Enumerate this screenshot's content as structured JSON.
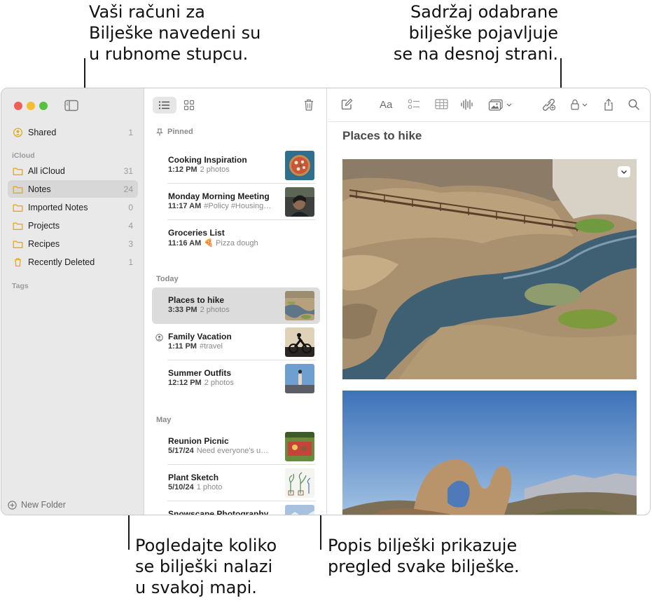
{
  "callouts": {
    "top_left": [
      "Vaši računi za",
      "Bilješke navedeni su",
      "u rubnome stupcu."
    ],
    "top_right": [
      "Sadržaj odabrane",
      "bilješke pojavljuje",
      "se na desnoj strani."
    ],
    "bottom_left": [
      "Pogledajte koliko",
      "se bilješki nalazi",
      "u svakoj mapi."
    ],
    "bottom_right": [
      "Popis bilješki prikazuje",
      "pregled svake bilješke."
    ]
  },
  "sidebar": {
    "shared": {
      "label": "Shared",
      "count": "1"
    },
    "account_header": "iCloud",
    "folders": [
      {
        "label": "All iCloud",
        "count": "31"
      },
      {
        "label": "Notes",
        "count": "24",
        "selected": true
      },
      {
        "label": "Imported Notes",
        "count": "0"
      },
      {
        "label": "Projects",
        "count": "4"
      },
      {
        "label": "Recipes",
        "count": "3"
      },
      {
        "label": "Recently Deleted",
        "count": "1"
      }
    ],
    "tags_header": "Tags",
    "new_folder": "New Folder"
  },
  "note_list": {
    "groups": {
      "pinned": "Pinned",
      "today": "Today",
      "may": "May"
    },
    "notes": [
      {
        "title": "Cooking Inspiration",
        "time": "1:12 PM",
        "subtitle": "2 photos",
        "thumb": "pizza"
      },
      {
        "title": "Monday Morning Meeting",
        "time": "11:17 AM",
        "subtitle": "#Policy #Housing…",
        "thumb": "person"
      },
      {
        "title": "Groceries List",
        "time": "11:16 AM",
        "subtitle": "🍕 Pizza dough"
      },
      {
        "title": "Places to hike",
        "time": "3:33 PM",
        "subtitle": "2 photos",
        "thumb": "river",
        "selected": true
      },
      {
        "title": "Family Vacation",
        "time": "1:11 PM",
        "subtitle": "#travel",
        "thumb": "cyclist",
        "shared": true
      },
      {
        "title": "Summer Outfits",
        "time": "12:12 PM",
        "subtitle": "2 photos",
        "thumb": "sky-person"
      },
      {
        "title": "Reunion Picnic",
        "time": "5/17/24",
        "subtitle": "Need everyone's u…",
        "thumb": "picnic"
      },
      {
        "title": "Plant Sketch",
        "time": "5/10/24",
        "subtitle": "1 photo",
        "thumb": "sketch"
      },
      {
        "title": "Snowscape Photography",
        "time": "",
        "subtitle": "",
        "thumb": "snow"
      }
    ]
  },
  "editor": {
    "title": "Places to hike",
    "format_label": "Aa"
  },
  "colors": {
    "sidebar_bg": "#e9e9e9",
    "selection": "#d7d7d7",
    "folder_icon": "#e3a826",
    "traffic_red": "#ee5f57",
    "traffic_yellow": "#f5bd2f",
    "traffic_green": "#58c13f"
  }
}
